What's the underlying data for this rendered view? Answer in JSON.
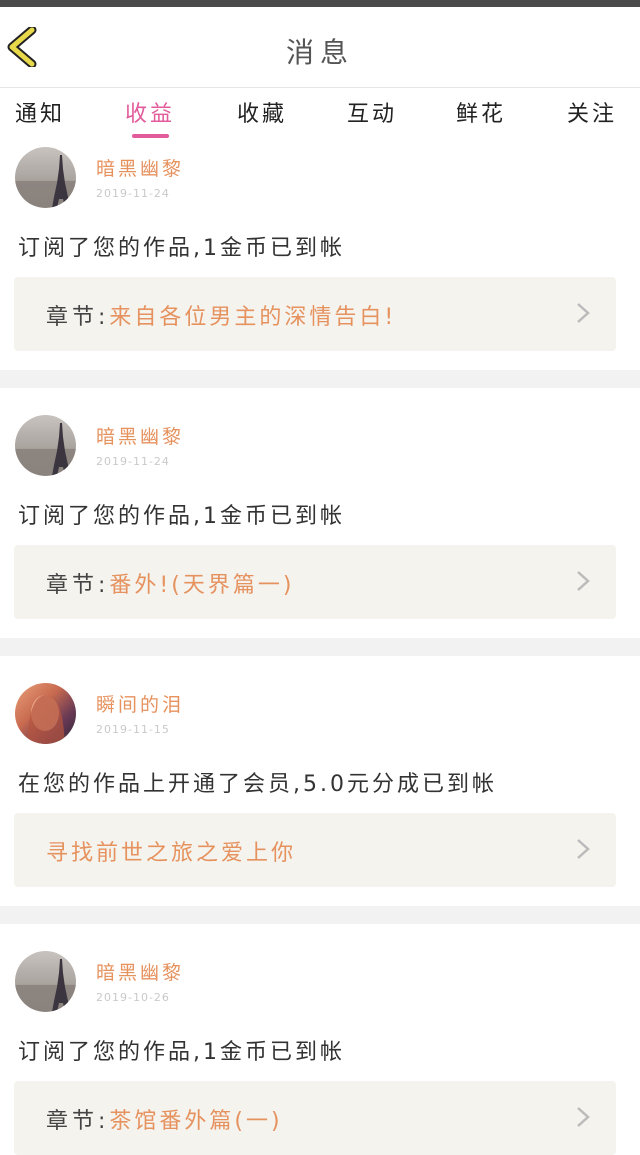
{
  "header": {
    "title": "消息"
  },
  "tabs": [
    {
      "label": "通知"
    },
    {
      "label": "收益"
    },
    {
      "label": "收藏"
    },
    {
      "label": "互动"
    },
    {
      "label": "鲜花"
    },
    {
      "label": "关注"
    }
  ],
  "active_tab": "收益",
  "messages": [
    {
      "username": "暗黑幽黎",
      "date": "2019-11-24",
      "text": "订阅了您的作品,1金币已到帐",
      "box_label": "章节:",
      "box_text": "来自各位男主的深情告白!",
      "avatar": "eiffel"
    },
    {
      "username": "暗黑幽黎",
      "date": "2019-11-24",
      "text": "订阅了您的作品,1金币已到帐",
      "box_label": "章节:",
      "box_text": "番外!(天界篇一)",
      "avatar": "eiffel"
    },
    {
      "username": "瞬间的泪",
      "date": "2019-11-15",
      "text": "在您的作品上开通了会员,5.0元分成已到帐",
      "box_label": "",
      "box_text": "寻找前世之旅之爱上你",
      "avatar": "girl"
    },
    {
      "username": "暗黑幽黎",
      "date": "2019-10-26",
      "text": "订阅了您的作品,1金币已到帐",
      "box_label": "章节:",
      "box_text": "茶馆番外篇(一)",
      "avatar": "eiffel"
    }
  ],
  "colors": {
    "accent": "#e25b9b",
    "name": "#e6925e",
    "box_bg": "#f4f3ee",
    "back_arrow": "#e8d94a"
  }
}
